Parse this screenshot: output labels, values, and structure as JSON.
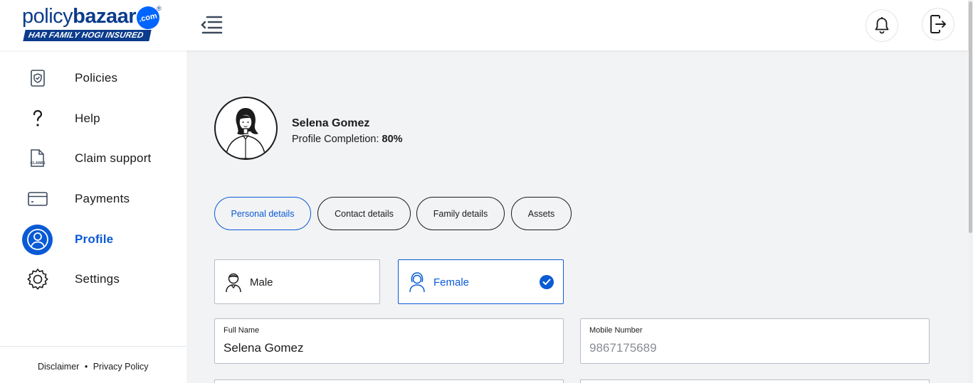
{
  "brand": {
    "name_light": "policy",
    "name_bold": "bazaar",
    "domain_badge": ".com",
    "registered_mark": "®",
    "tagline": "HAR FAMILY HOGI INSURED",
    "primary_color": "#0a5ad6",
    "logo_color": "#0b3b8c"
  },
  "header": {
    "menu_icon": "menu-collapse-icon",
    "notifications_icon": "bell-icon",
    "logout_icon": "logout-icon"
  },
  "sidebar": {
    "items": [
      {
        "label": "Policies",
        "icon": "shield-document-icon",
        "active": false
      },
      {
        "label": "Help",
        "icon": "question-icon",
        "active": false
      },
      {
        "label": "Claim support",
        "icon": "claims-document-icon",
        "active": false
      },
      {
        "label": "Payments",
        "icon": "card-icon",
        "active": false
      },
      {
        "label": "Profile",
        "icon": "user-icon",
        "active": true
      },
      {
        "label": "Settings",
        "icon": "gear-icon",
        "active": false
      }
    ],
    "footer": {
      "disclaimer": "Disclaimer",
      "separator": "•",
      "privacy": "Privacy Policy"
    }
  },
  "profile": {
    "name": "Selena Gomez",
    "completion_label": "Profile Completion:",
    "completion_value": "80%",
    "completion_fraction": 0.8
  },
  "tabs": [
    {
      "label": "Personal details",
      "active": true
    },
    {
      "label": "Contact details",
      "active": false
    },
    {
      "label": "Family details",
      "active": false
    },
    {
      "label": "Assets",
      "active": false
    }
  ],
  "gender": {
    "options": [
      {
        "label": "Male",
        "selected": false
      },
      {
        "label": "Female",
        "selected": true
      }
    ]
  },
  "form": {
    "full_name": {
      "label": "Full Name",
      "value": "Selena Gomez"
    },
    "mobile": {
      "label": "Mobile Number",
      "value": "9867175689"
    }
  }
}
